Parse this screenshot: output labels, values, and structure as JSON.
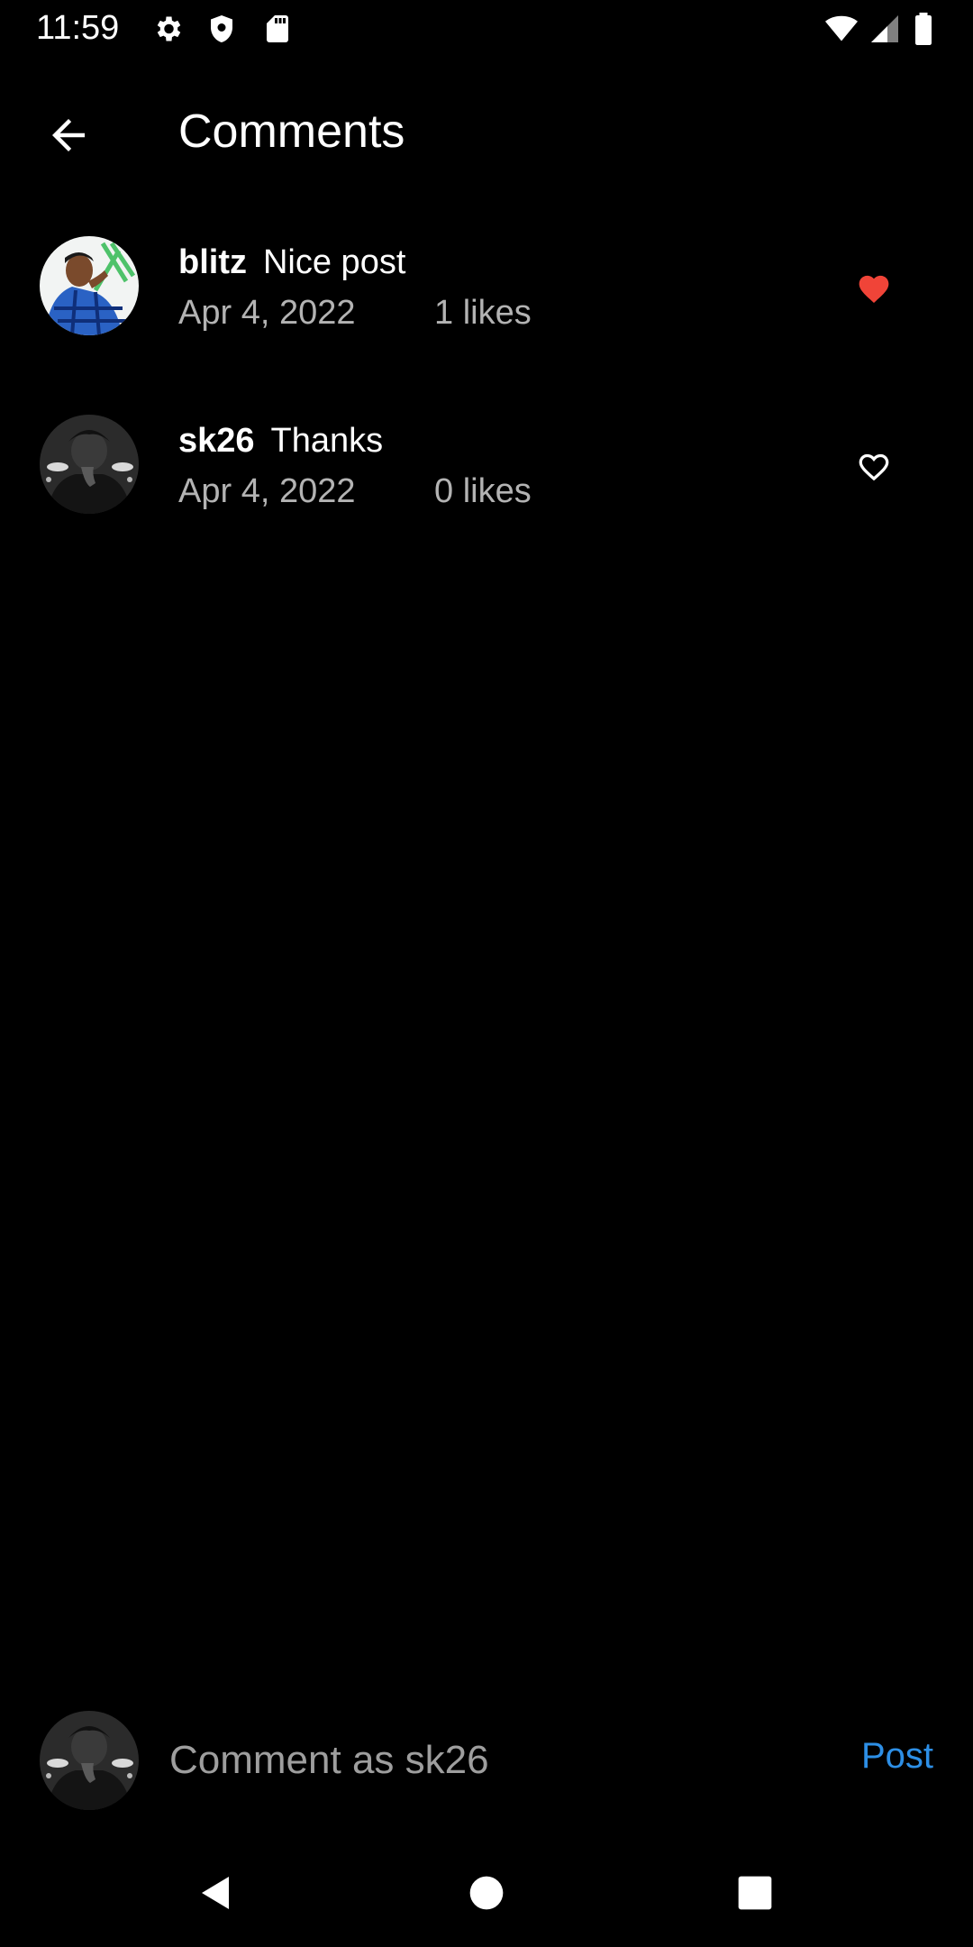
{
  "status_bar": {
    "time": "11:59",
    "left_icons": [
      "gear-icon",
      "shield-icon",
      "sd-card-icon"
    ],
    "right_icons": [
      "wifi-icon",
      "signal-icon",
      "battery-icon"
    ]
  },
  "header": {
    "title": "Comments",
    "back_icon": "arrow-left-icon"
  },
  "comments": [
    {
      "username": "blitz",
      "text": "Nice post",
      "date": "Apr 4, 2022",
      "likes": "1 likes",
      "liked": true
    },
    {
      "username": "sk26",
      "text": "Thanks",
      "date": "Apr 4, 2022",
      "likes": "0 likes",
      "liked": false
    }
  ],
  "composer": {
    "placeholder": "Comment as sk26",
    "post_label": "Post"
  },
  "colors": {
    "background": "#000000",
    "liked_heart": "#f04438",
    "post_accent": "#2d8fe6",
    "secondary_text": "#b3b3b3"
  }
}
